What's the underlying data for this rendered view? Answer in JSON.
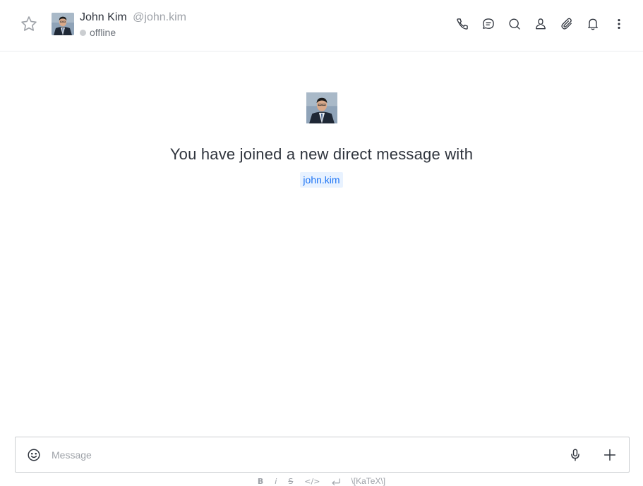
{
  "header": {
    "name": "John Kim",
    "handle": "@john.kim",
    "status": "offline",
    "status_color": "#cbced1",
    "favorite_icon": "star-icon",
    "toolbar": [
      {
        "name": "call-button",
        "icon": "phone-icon"
      },
      {
        "name": "discussion-button",
        "icon": "discussion-icon"
      },
      {
        "name": "search-button",
        "icon": "search-icon"
      },
      {
        "name": "user-info-button",
        "icon": "user-icon"
      },
      {
        "name": "files-button",
        "icon": "paperclip-icon"
      },
      {
        "name": "notifications-button",
        "icon": "bell-icon"
      },
      {
        "name": "kebab-menu-button",
        "icon": "kebab-icon"
      }
    ]
  },
  "intro": {
    "text": "You have joined a new direct message with",
    "mention": "john.kim",
    "mention_color": "#1d74f5"
  },
  "composer": {
    "placeholder": "Message"
  },
  "formatting": {
    "bold": "B",
    "italic": "i",
    "strike": "S",
    "code": "</>",
    "katex": "\\[KaTeX\\]"
  }
}
